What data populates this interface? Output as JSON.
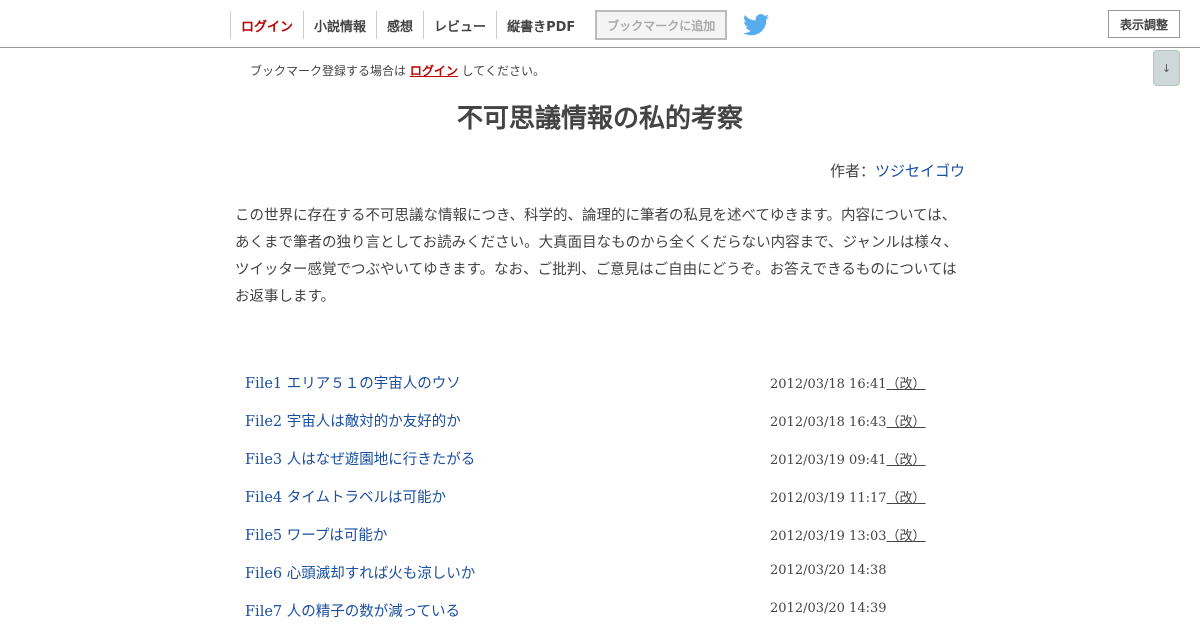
{
  "nav": {
    "items": [
      {
        "label": "ログイン",
        "kind": "login"
      },
      {
        "label": "小説情報",
        "kind": "normal"
      },
      {
        "label": "感想",
        "kind": "normal"
      },
      {
        "label": "レビュー",
        "kind": "normal"
      },
      {
        "label": "縦書きPDF",
        "kind": "normal"
      }
    ],
    "bookmark_label": "ブックマークに追加",
    "twitter_icon": "twitter-icon",
    "display_settings_label": "表示調整"
  },
  "scroll_button": "↓",
  "notice": {
    "before": "ブックマーク登録する場合は ",
    "login_link": "ログイン",
    "after": " してください。"
  },
  "novel": {
    "title": "不可思議情報の私的考察",
    "author_prefix": "作者：",
    "author_name": "ツジセイゴウ",
    "summary": "この世界に存在する不可思議な情報につき、科学的、論理的に筆者の私見を述べてゆきます。内容については、あくまで筆者の独り言としてお読みください。大真面目なものから全くくだらない内容まで、ジャンルは様々、ツイッター感覚でつぶやいてゆきます。なお、ご批判、ご意見はご自由にどうぞ。お答えできるものについてはお返事します。"
  },
  "chapters": [
    {
      "title": "File1 エリア５１の宇宙人のウソ",
      "date": "2012/03/18 16:41",
      "revised": "（改）"
    },
    {
      "title": "File2 宇宙人は敵対的か友好的か",
      "date": "2012/03/18 16:43",
      "revised": "（改）"
    },
    {
      "title": "File3 人はなぜ遊園地に行きたがる",
      "date": "2012/03/19 09:41",
      "revised": "（改）"
    },
    {
      "title": "File4 タイムトラベルは可能か",
      "date": "2012/03/19 11:17",
      "revised": "（改）"
    },
    {
      "title": "File5 ワープは可能か",
      "date": "2012/03/19 13:03",
      "revised": "（改）"
    },
    {
      "title": "File6 心頭滅却すれば火も涼しいか",
      "date": "2012/03/20 14:38",
      "revised": ""
    },
    {
      "title": "File7 人の精子の数が減っている",
      "date": "2012/03/20 14:39",
      "revised": ""
    }
  ],
  "colors": {
    "link": "#1a4fa0",
    "login": "#bb0000",
    "twitter": "#55acee"
  }
}
